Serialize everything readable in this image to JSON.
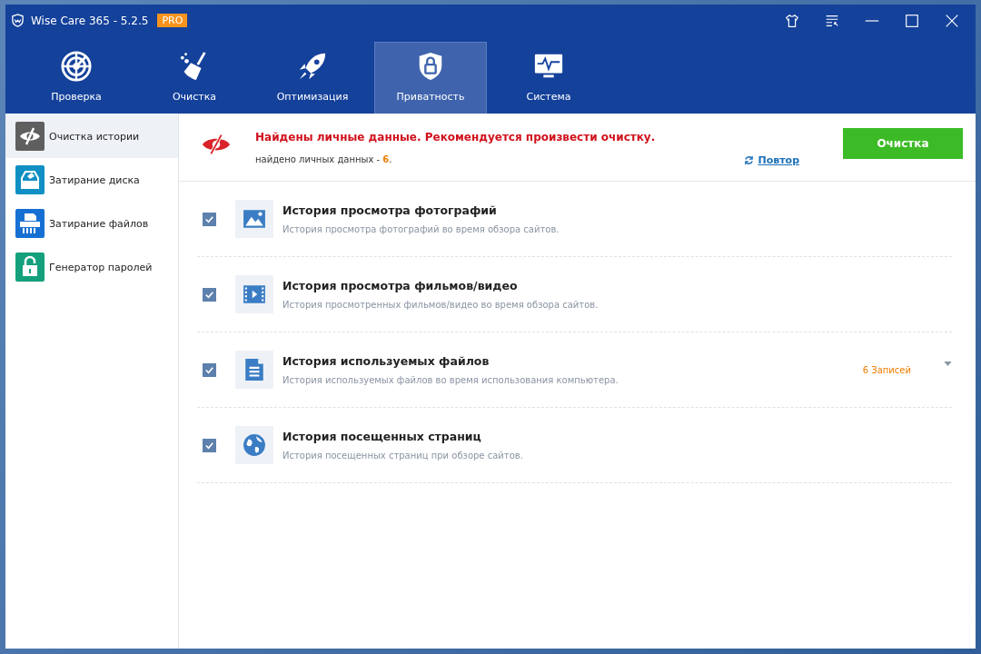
{
  "window": {
    "title": "Wise Care 365 - 5.2.5",
    "badge": "PRO"
  },
  "tabs": [
    {
      "label": "Проверка",
      "selected": false
    },
    {
      "label": "Очистка",
      "selected": false
    },
    {
      "label": "Оптимизация",
      "selected": false
    },
    {
      "label": "Приватность",
      "selected": true
    },
    {
      "label": "Система",
      "selected": false
    }
  ],
  "sidebar": {
    "items": [
      {
        "label": "Очистка истории",
        "selected": true,
        "color": "#5f5f5f"
      },
      {
        "label": "Затирание диска",
        "selected": false,
        "color": "#0f8fc4"
      },
      {
        "label": "Затирание файлов",
        "selected": false,
        "color": "#1670d3"
      },
      {
        "label": "Генератор паролей",
        "selected": false,
        "color": "#14a07c"
      }
    ]
  },
  "alert": {
    "headline": "Найдены личные данные. Рекомендуется произвести очистку.",
    "found_label": "найдено личных данных - ",
    "found_count": "6",
    "found_end": ".",
    "retry": "Повтор",
    "clean_button": "Очистка"
  },
  "items": [
    {
      "title": "История просмотра фотографий",
      "description": "История просмотра фотографий во время обзора сайтов.",
      "checked": true
    },
    {
      "title": "История просмотра фильмов/видео",
      "description": "История просмотренных фильмов/видео во время обзора сайтов.",
      "checked": true
    },
    {
      "title": "История используемых файлов",
      "description": "История используемых файлов во время использования компьютера.",
      "checked": true,
      "count": "6 Записей",
      "expanded": false
    },
    {
      "title": "История посещенных страниц",
      "description": "История посещенных страниц при обзоре сайтов.",
      "checked": true
    }
  ]
}
